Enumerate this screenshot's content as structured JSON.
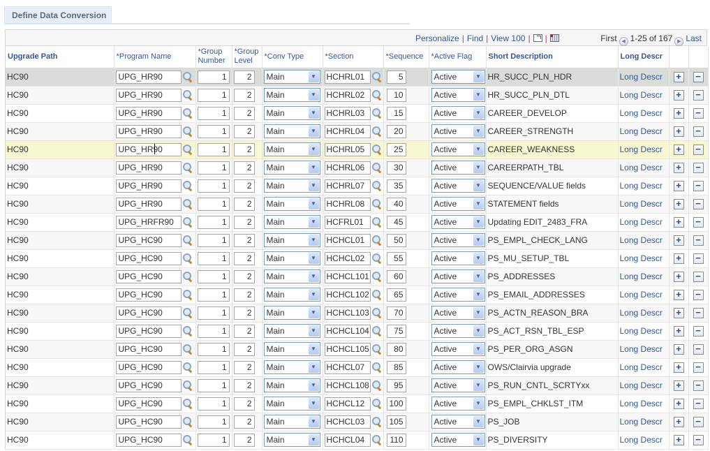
{
  "page": {
    "tab_label": "Define Data Conversion"
  },
  "grid_nav": {
    "personalize": "Personalize",
    "find": "Find",
    "view_all": "View 100",
    "first": "First",
    "range": "1-25 of 167",
    "last": "Last"
  },
  "columns": [
    "Upgrade Path",
    "*Program Name",
    "*Group Number",
    "*Group Level",
    "*Conv Type",
    "*Section",
    "*Sequence",
    "*Active Flag",
    "Short Description",
    "Long Descr"
  ],
  "columns_split": {
    "group_number": [
      "*Group",
      "Number"
    ],
    "group_level": [
      "*Group",
      "Level"
    ]
  },
  "rows": [
    {
      "path": "HC90",
      "program": "UPG_HR90",
      "group_number": "1",
      "group_level": "2",
      "conv_type": "Main",
      "section": "HCHRL01",
      "sequence": "5",
      "active_flag": "Active",
      "short_descr": "HR_SUCC_PLN_HDR",
      "long_descr": "Long Descr"
    },
    {
      "path": "HC90",
      "program": "UPG_HR90",
      "group_number": "1",
      "group_level": "2",
      "conv_type": "Main",
      "section": "HCHRL02",
      "sequence": "10",
      "active_flag": "Active",
      "short_descr": "HR_SUCC_PLN_DTL",
      "long_descr": "Long Descr"
    },
    {
      "path": "HC90",
      "program": "UPG_HR90",
      "group_number": "1",
      "group_level": "2",
      "conv_type": "Main",
      "section": "HCHRL03",
      "sequence": "15",
      "active_flag": "Active",
      "short_descr": "CAREER_DEVELOP",
      "long_descr": "Long Descr"
    },
    {
      "path": "HC90",
      "program": "UPG_HR90",
      "group_number": "1",
      "group_level": "2",
      "conv_type": "Main",
      "section": "HCHRL04",
      "sequence": "20",
      "active_flag": "Active",
      "short_descr": "CAREER_STRENGTH",
      "long_descr": "Long Descr"
    },
    {
      "path": "HC90",
      "program": "UPG_HR90",
      "group_number": "1",
      "group_level": "2",
      "conv_type": "Main",
      "section": "HCHRL05",
      "sequence": "25",
      "active_flag": "Active",
      "short_descr": "CAREER_WEAKNESS",
      "long_descr": "Long Descr"
    },
    {
      "path": "HC90",
      "program": "UPG_HR90",
      "group_number": "1",
      "group_level": "2",
      "conv_type": "Main",
      "section": "HCHRL06",
      "sequence": "30",
      "active_flag": "Active",
      "short_descr": "CAREERPATH_TBL",
      "long_descr": "Long Descr"
    },
    {
      "path": "HC90",
      "program": "UPG_HR90",
      "group_number": "1",
      "group_level": "2",
      "conv_type": "Main",
      "section": "HCHRL07",
      "sequence": "35",
      "active_flag": "Active",
      "short_descr": "SEQUENCE/VALUE fields",
      "long_descr": "Long Descr"
    },
    {
      "path": "HC90",
      "program": "UPG_HR90",
      "group_number": "1",
      "group_level": "2",
      "conv_type": "Main",
      "section": "HCHRL08",
      "sequence": "40",
      "active_flag": "Active",
      "short_descr": "STATEMENT fields",
      "long_descr": "Long Descr"
    },
    {
      "path": "HC90",
      "program": "UPG_HRFR90",
      "group_number": "1",
      "group_level": "2",
      "conv_type": "Main",
      "section": "HCFRL01",
      "sequence": "45",
      "active_flag": "Active",
      "short_descr": "Updating EDIT_2483_FRA",
      "long_descr": "Long Descr"
    },
    {
      "path": "HC90",
      "program": "UPG_HC90",
      "group_number": "1",
      "group_level": "2",
      "conv_type": "Main",
      "section": "HCHCL01",
      "sequence": "50",
      "active_flag": "Active",
      "short_descr": "PS_EMPL_CHECK_LANG",
      "long_descr": "Long Descr"
    },
    {
      "path": "HC90",
      "program": "UPG_HC90",
      "group_number": "1",
      "group_level": "2",
      "conv_type": "Main",
      "section": "HCHCL02",
      "sequence": "55",
      "active_flag": "Active",
      "short_descr": "PS_MU_SETUP_TBL",
      "long_descr": "Long Descr"
    },
    {
      "path": "HC90",
      "program": "UPG_HC90",
      "group_number": "1",
      "group_level": "2",
      "conv_type": "Main",
      "section": "HCHCL101",
      "sequence": "60",
      "active_flag": "Active",
      "short_descr": "PS_ADDRESSES",
      "long_descr": "Long Descr"
    },
    {
      "path": "HC90",
      "program": "UPG_HC90",
      "group_number": "1",
      "group_level": "2",
      "conv_type": "Main",
      "section": "HCHCL102",
      "sequence": "65",
      "active_flag": "Active",
      "short_descr": "PS_EMAIL_ADDRESSES",
      "long_descr": "Long Descr"
    },
    {
      "path": "HC90",
      "program": "UPG_HC90",
      "group_number": "1",
      "group_level": "2",
      "conv_type": "Main",
      "section": "HCHCL103",
      "sequence": "70",
      "active_flag": "Active",
      "short_descr": "PS_ACTN_REASON_BRA",
      "long_descr": "Long Descr"
    },
    {
      "path": "HC90",
      "program": "UPG_HC90",
      "group_number": "1",
      "group_level": "2",
      "conv_type": "Main",
      "section": "HCHCL104",
      "sequence": "75",
      "active_flag": "Active",
      "short_descr": "PS_ACT_RSN_TBL_ESP",
      "long_descr": "Long Descr"
    },
    {
      "path": "HC90",
      "program": "UPG_HC90",
      "group_number": "1",
      "group_level": "2",
      "conv_type": "Main",
      "section": "HCHCL105",
      "sequence": "80",
      "active_flag": "Active",
      "short_descr": "PS_PER_ORG_ASGN",
      "long_descr": "Long Descr"
    },
    {
      "path": "HC90",
      "program": "UPG_HC90",
      "group_number": "1",
      "group_level": "2",
      "conv_type": "Main",
      "section": "HCHCL07",
      "sequence": "85",
      "active_flag": "Active",
      "short_descr": "OWS/Clairvia upgrade",
      "long_descr": "Long Descr"
    },
    {
      "path": "HC90",
      "program": "UPG_HC90",
      "group_number": "1",
      "group_level": "2",
      "conv_type": "Main",
      "section": "HCHCL108",
      "sequence": "95",
      "active_flag": "Active",
      "short_descr": "PS_RUN_CNTL_SCRTYxx",
      "long_descr": "Long Descr"
    },
    {
      "path": "HC90",
      "program": "UPG_HC90",
      "group_number": "1",
      "group_level": "2",
      "conv_type": "Main",
      "section": "HCHCL12",
      "sequence": "100",
      "active_flag": "Active",
      "short_descr": "PS_EMPL_CHKLST_ITM",
      "long_descr": "Long Descr"
    },
    {
      "path": "HC90",
      "program": "UPG_HC90",
      "group_number": "1",
      "group_level": "2",
      "conv_type": "Main",
      "section": "HCHCL03",
      "sequence": "105",
      "active_flag": "Active",
      "short_descr": "PS_JOB",
      "long_descr": "Long Descr"
    },
    {
      "path": "HC90",
      "program": "UPG_HC90",
      "group_number": "1",
      "group_level": "2",
      "conv_type": "Main",
      "section": "HCHCL04",
      "sequence": "110",
      "active_flag": "Active",
      "short_descr": "PS_DIVERSITY",
      "long_descr": "Long Descr"
    }
  ],
  "row_state": {
    "selected_index": 0,
    "hover_index": 4
  },
  "icons": {
    "add_row": "+",
    "delete_row": "−",
    "dropdown": "▼",
    "prev": "◀",
    "next": "▶"
  }
}
